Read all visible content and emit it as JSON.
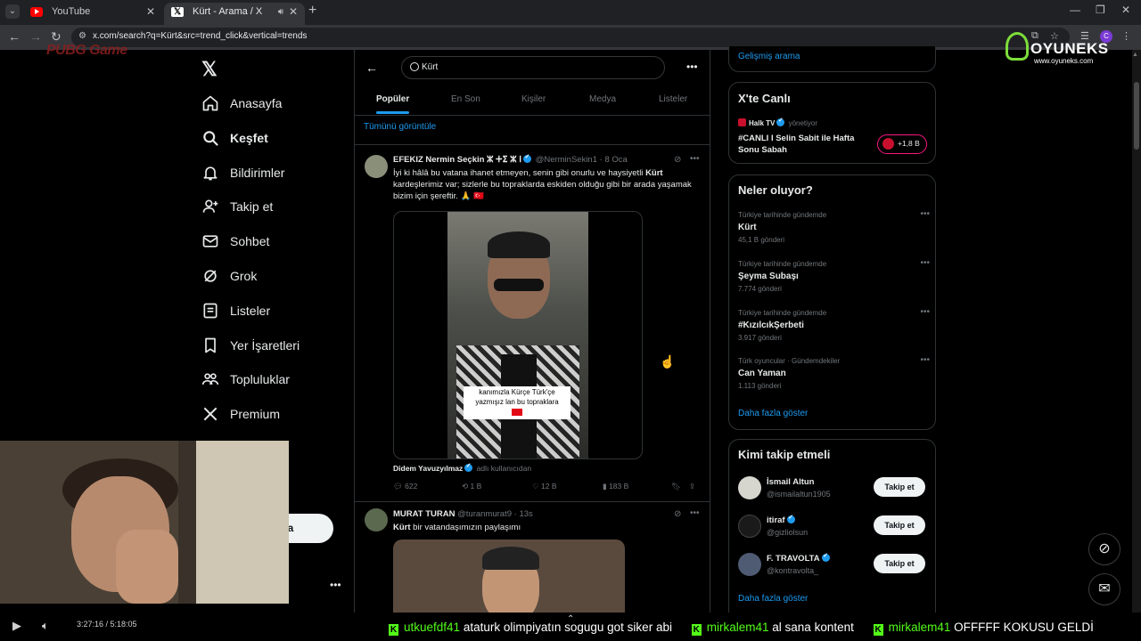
{
  "browser": {
    "tabs": [
      {
        "title": "YouTube"
      },
      {
        "title": "Kürt - Arama / X"
      }
    ],
    "url": "x.com/search?q=Kürt&src=trend_click&vertical=trends",
    "profile_initial": "C"
  },
  "overlays": {
    "stream_logo": "PUBG Game",
    "sponsor_name": "OYUNEKS",
    "sponsor_site": "www.oyuneks.com"
  },
  "nav": {
    "items": [
      {
        "label": "Anasayfa",
        "icon": "home-icon"
      },
      {
        "label": "Keşfet",
        "icon": "search-icon"
      },
      {
        "label": "Bildirimler",
        "icon": "bell-icon"
      },
      {
        "label": "Takip et",
        "icon": "person-plus-icon"
      },
      {
        "label": "Sohbet",
        "icon": "mail-icon"
      },
      {
        "label": "Grok",
        "icon": "grok-icon"
      },
      {
        "label": "Listeler",
        "icon": "list-icon"
      },
      {
        "label": "Yer İşaretleri",
        "icon": "bookmark-icon"
      },
      {
        "label": "Topluluklar",
        "icon": "people-icon"
      },
      {
        "label": "Premium",
        "icon": "x-icon"
      }
    ],
    "post_button_label": "nla"
  },
  "search": {
    "query": "Kürt",
    "tabs": [
      "Popüler",
      "En Son",
      "Kişiler",
      "Medya",
      "Listeler"
    ],
    "active_tab": "Popüler",
    "see_all": "Tümünü görüntüle"
  },
  "tweets": [
    {
      "name": "EFEKIZ Nermin Seçkin ⵣ ⵜⵉ ⵣ ⵏ",
      "handle": "@NerminSekin1",
      "time": "· 8 Oca",
      "text_before": "İyi ki hâlâ bu vatana ihanet etmeyen, senin gibi onurlu ve haysiyetli ",
      "text_bold": "Kürt",
      "text_after": " kardeşlerimiz var; sizlerle bu topraklarda eskiden olduğu gibi bir arada yaşamak bizim için şereftir. 🙏 🇹🇷",
      "video_caption": "kanımızla Kürçe Türk'çe yazmışız lan bu topraklara",
      "attribution_name": "Didem Yavuzyılmaz",
      "attribution_suffix": "adlı kullanıcıdan",
      "replies": "622",
      "reposts": "1 B",
      "likes": "12 B",
      "views": "183 B"
    },
    {
      "name": "MURAT TURAN",
      "handle": "@turanmurat9",
      "time": "· 13s",
      "text_bold": "Kürt",
      "text_after": " bir vatandaşımızın  paylaşımı"
    }
  ],
  "sidebar": {
    "advanced_search": "Gelişmiş arama",
    "live": {
      "heading": "X'te Canlı",
      "source": "Halk TV",
      "source_suffix": "yönetiyor",
      "title": "#CANLI I Selin Sabit ile Hafta Sonu Sabah",
      "listeners": "+1,8 B"
    },
    "trends": {
      "heading": "Neler oluyor?",
      "items": [
        {
          "context": "Türkiye tarihinde gündemde",
          "name": "Kürt",
          "posts": "45,1 B gönderi"
        },
        {
          "context": "Türkiye tarihinde gündemde",
          "name": "Şeyma Subaşı",
          "posts": "7.774 gönderi"
        },
        {
          "context": "Türkiye tarihinde gündemde",
          "name": "#KızılcıkŞerbeti",
          "posts": "3.917 gönderi"
        },
        {
          "context": "Türk oyuncular · Gündemdekiler",
          "name": "Can Yaman",
          "posts": "1.113 gönderi"
        }
      ],
      "show_more": "Daha fazla göster"
    },
    "who_to_follow": {
      "heading": "Kimi takip etmeli",
      "items": [
        {
          "name": "İsmail Altun",
          "handle": "@ismailaltun1905",
          "verified": true,
          "button": "Takip et"
        },
        {
          "name": "itiraf",
          "handle": "@gizliolsun",
          "verified": true,
          "button": "Takip et"
        },
        {
          "name": "F. TRAVOLTA",
          "handle": "@kontravolta_",
          "verified": true,
          "button": "Takip et"
        }
      ],
      "show_more": "Daha fazla göster"
    }
  },
  "player": {
    "time": "3:27:16 / 5:18:05"
  },
  "chat_ticker": [
    {
      "user": "utkuefdf41",
      "message": "ataturk olimpiyatın sogugu got siker abi"
    },
    {
      "user": "mirkalem41",
      "message": "al sana kontent"
    },
    {
      "user": "mirkalem41",
      "message": "OFFFFF KOKUSU GELDİ"
    }
  ],
  "colors": {
    "accent": "#1d9bf0",
    "background": "#000000",
    "kick_green": "#53fc18",
    "live_pink": "#f91880"
  }
}
